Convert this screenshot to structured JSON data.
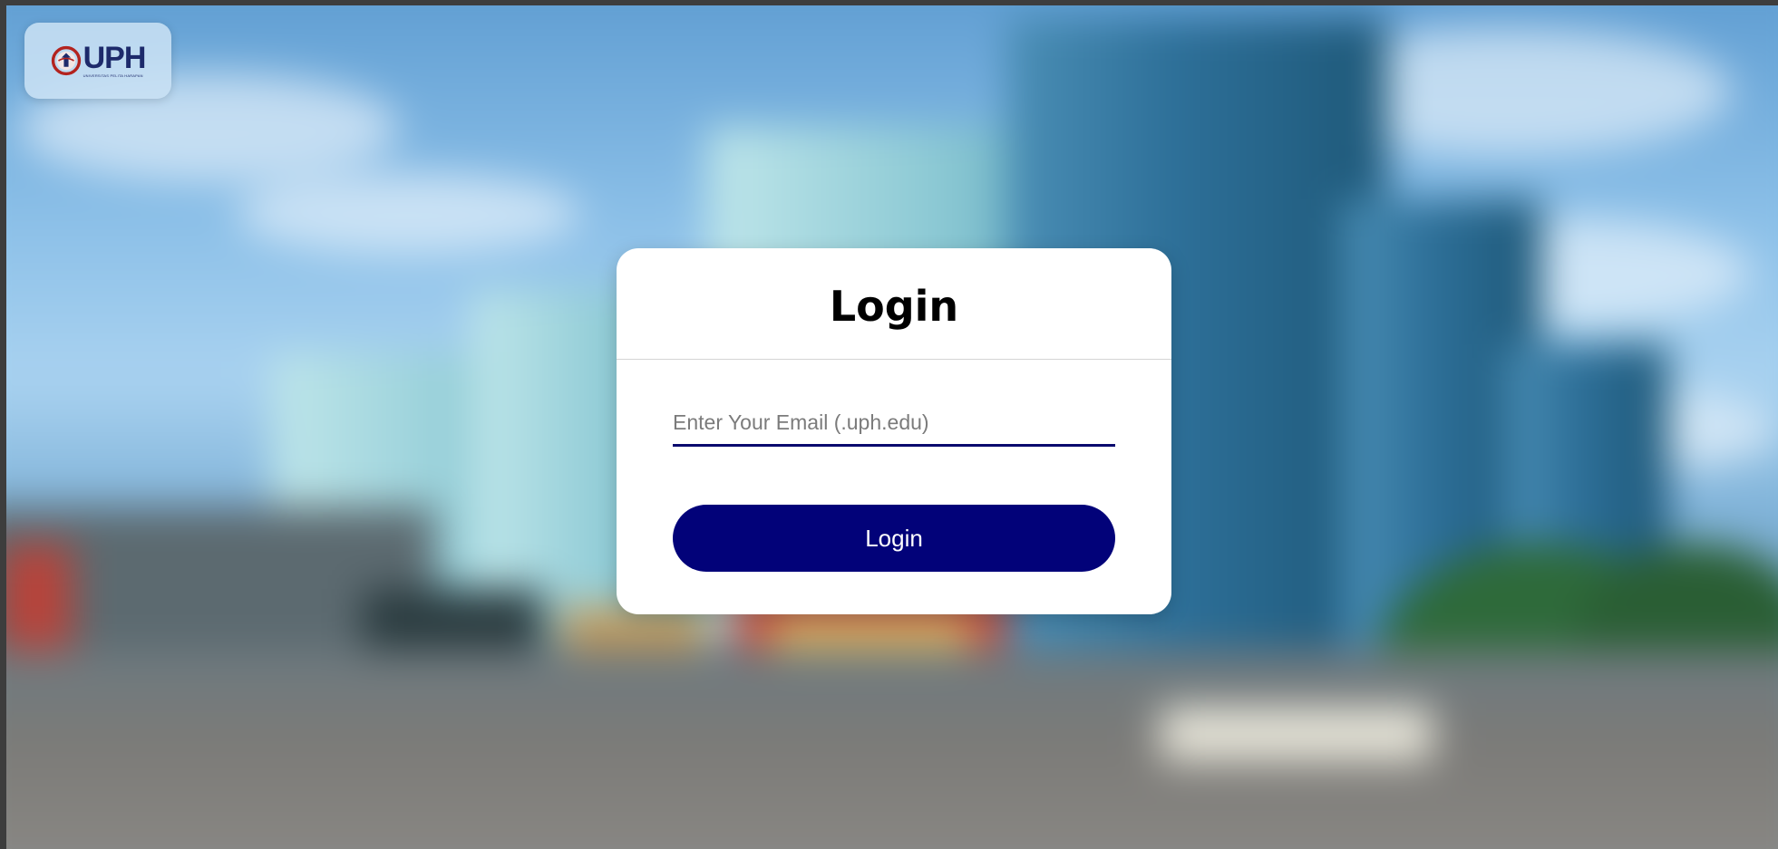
{
  "brand": {
    "logo_text": "UPH",
    "logo_subtitle": "UNIVERSITAS PELITA HARAPAN"
  },
  "login": {
    "title": "Login",
    "email_placeholder": "Enter Your Email (.uph.edu)",
    "email_value": "",
    "button_label": "Login"
  },
  "colors": {
    "primary": "#020279",
    "card": "#ffffff",
    "logo_text": "#1d2a6b"
  },
  "icons": {
    "logo": "uph-emblem-icon"
  }
}
